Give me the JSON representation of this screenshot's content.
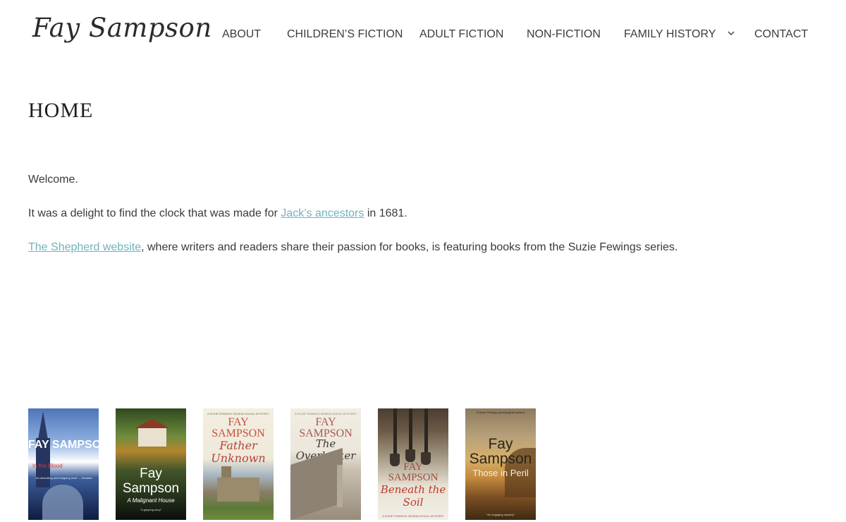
{
  "site": {
    "logo_text": "Fay Sampson"
  },
  "nav": {
    "items": [
      {
        "label": "ABOUT"
      },
      {
        "label": "CHILDREN’S FICTION"
      },
      {
        "label": "ADULT FICTION"
      },
      {
        "label": "NON-FICTION"
      },
      {
        "label": "FAMILY HISTORY",
        "has_dropdown": true,
        "icon": "chevron-down-icon"
      },
      {
        "label": "CONTACT"
      }
    ]
  },
  "page": {
    "title": "HOME",
    "paragraphs": [
      {
        "text": "Welcome."
      },
      {
        "before": "It was a delight to find the clock that was made for ",
        "link": "Jack’s ancestors",
        "after": " in 1681."
      },
      {
        "before": "",
        "link": "The Shepherd website",
        "after": ", where writers and readers share their passion for books, is featuring books from the Suzie Fewings series."
      }
    ],
    "link_color": "#6fb3bd"
  },
  "covers": [
    {
      "author": "FAY SAMPSON",
      "title": "In the Blood",
      "quote": "\"An absorbing and intriguing read\" — Booklist"
    },
    {
      "author": "Fay Sampson",
      "title": "A Malignant House",
      "quote": "\"A gripping story\""
    },
    {
      "tag": "A SUZIE FEWINGS GENEALOGICAL MYSTERY",
      "author": "FAY SAMPSON",
      "title": "Father Unknown"
    },
    {
      "tag": "A SUZIE FEWINGS GENEALOGICAL MYSTERY",
      "author": "FAY SAMPSON",
      "title": "The Overlooker"
    },
    {
      "author": "FAY SAMPSON",
      "title": "Beneath the Soil",
      "tag": "A SUZIE FEWINGS GENEALOGICAL MYSTERY"
    },
    {
      "tag": "A Suzie Fewings genealogical mystery",
      "author": "Fay Sampson",
      "title": "Those in Peril",
      "quote": "\"An engaging mystery\""
    }
  ]
}
